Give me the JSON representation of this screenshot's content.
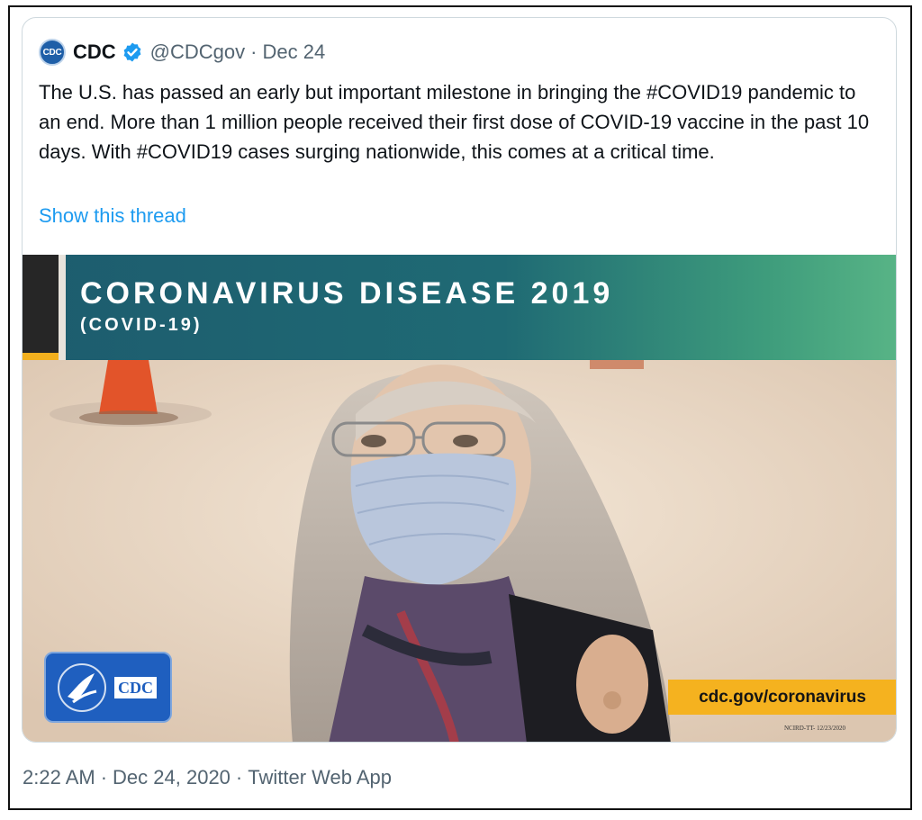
{
  "tweet": {
    "avatar_text": "CDC",
    "author_name": "CDC",
    "handle": "@CDCgov",
    "separator": "·",
    "relative_date": "Dec 24",
    "text": "The U.S. has passed an early but important milestone in bringing the #COVID19 pandemic to an end. More than 1 million people received their first dose of COVID-19 vaccine in the past 10 days. With #COVID19 cases surging nationwide, this comes at a critical time.",
    "show_thread_label": "Show this thread",
    "verified_icon": "verified-badge-icon"
  },
  "media": {
    "banner_title": "CORONAVIRUS DISEASE 2019",
    "banner_subtitle": "(COVID-19)",
    "logo_text": "CDC",
    "url_text": "cdc.gov/coronavirus",
    "code_text": "NCIRD-TT- 12/23/2020",
    "colors": {
      "banner_start": "#1d5c6e",
      "banner_end": "#58b486",
      "url_box": "#f5b21f",
      "logo_bg": "#1f5fbf"
    }
  },
  "footer": {
    "time": "2:22 AM",
    "date": "Dec 24, 2020",
    "source": "Twitter Web App",
    "separator": "·"
  },
  "colors": {
    "link": "#1d9bf0",
    "muted": "#536471",
    "verified": "#1d9bf0"
  }
}
